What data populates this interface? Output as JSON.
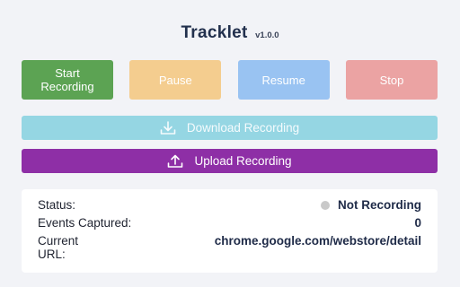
{
  "app": {
    "title": "Tracklet",
    "version": "v1.0.0"
  },
  "controls": {
    "start_label": "Start\nRecording",
    "pause_label": "Pause",
    "resume_label": "Resume",
    "stop_label": "Stop"
  },
  "actions": {
    "download_label": "Download Recording",
    "upload_label": "Upload Recording",
    "download_icon": "download-icon",
    "upload_icon": "upload-icon"
  },
  "status": {
    "status_label": "Status:",
    "status_value": "Not Recording",
    "status_dot_color": "#c9c9c9",
    "events_label": "Events Captured:",
    "events_value": "0",
    "url_label": "Current\nURL:",
    "url_value": "chrome.google.com/webstore/detail"
  },
  "colors": {
    "start": "#5ca353",
    "pause": "#f4cd8f",
    "resume": "#99c3f2",
    "stop": "#eba3a3",
    "download": "#95d6e3",
    "upload": "#8e2fa6"
  }
}
